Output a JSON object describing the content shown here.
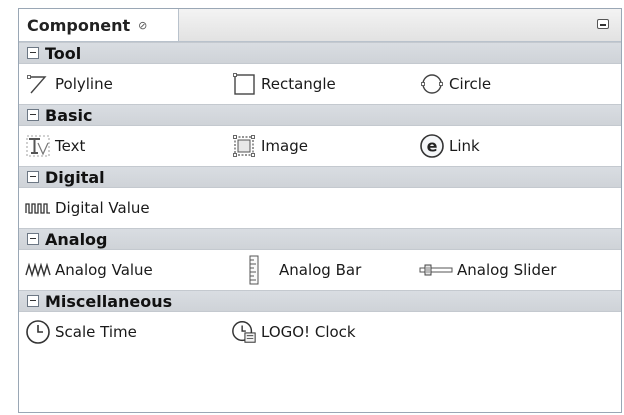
{
  "panel": {
    "tab_label": "Component",
    "tab_close_glyph": "⊘"
  },
  "sections": [
    {
      "title": "Tool",
      "items": [
        {
          "label": "Polyline",
          "icon": "polyline-icon"
        },
        {
          "label": "Rectangle",
          "icon": "rectangle-icon"
        },
        {
          "label": "Circle",
          "icon": "circle-icon"
        }
      ]
    },
    {
      "title": "Basic",
      "items": [
        {
          "label": "Text",
          "icon": "text-icon"
        },
        {
          "label": "Image",
          "icon": "image-icon"
        },
        {
          "label": "Link",
          "icon": "link-icon"
        }
      ]
    },
    {
      "title": "Digital",
      "items": [
        {
          "label": "Digital Value",
          "icon": "digital-value-icon"
        }
      ]
    },
    {
      "title": "Analog",
      "items": [
        {
          "label": "Analog Value",
          "icon": "analog-value-icon"
        },
        {
          "label": "Analog Bar",
          "icon": "analog-bar-icon"
        },
        {
          "label": "Analog Slider",
          "icon": "analog-slider-icon"
        }
      ]
    },
    {
      "title": "Miscellaneous",
      "items": [
        {
          "label": "Scale Time",
          "icon": "scale-time-icon"
        },
        {
          "label": "LOGO! Clock",
          "icon": "logo-clock-icon"
        }
      ]
    }
  ]
}
